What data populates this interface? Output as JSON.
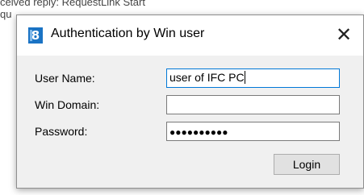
{
  "background": {
    "line1": "ceived reply: RequestLink Start",
    "line2": "qu"
  },
  "dialog": {
    "icon_text": "8",
    "title": "Authentication by Win user",
    "close_symbol": "✕"
  },
  "form": {
    "username_label": "User Name:",
    "username_value": "user of IFC PC",
    "domain_label": "Win Domain:",
    "domain_value": "",
    "password_label": "Password:",
    "password_mask": "●●●●●●●●●●",
    "login_label": "Login"
  },
  "colors": {
    "focus_border": "#0078d7",
    "client_bg": "#f0f0f0",
    "icon_bg": "#1a73c4"
  }
}
